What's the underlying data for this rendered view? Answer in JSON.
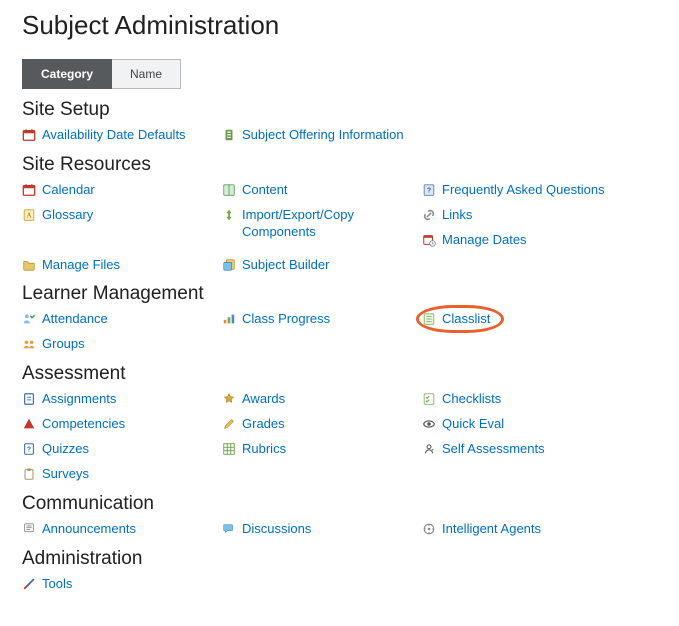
{
  "pageTitle": "Subject Administration",
  "tabs": {
    "category": "Category",
    "name": "Name"
  },
  "sections": {
    "siteSetup": {
      "heading": "Site Setup",
      "items": {
        "availabilityDateDefaults": "Availability Date Defaults",
        "subjectOfferingInformation": "Subject Offering Information"
      }
    },
    "siteResources": {
      "heading": "Site Resources",
      "items": {
        "calendar": "Calendar",
        "content": "Content",
        "faq": "Frequently Asked Questions",
        "glossary": "Glossary",
        "importExportCopy": "Import/Export/Copy Components",
        "links": "Links",
        "manageDates": "Manage Dates",
        "manageFiles": "Manage Files",
        "subjectBuilder": "Subject Builder"
      }
    },
    "learnerManagement": {
      "heading": "Learner Management",
      "items": {
        "attendance": "Attendance",
        "classProgress": "Class Progress",
        "classlist": "Classlist",
        "groups": "Groups"
      }
    },
    "assessment": {
      "heading": "Assessment",
      "items": {
        "assignments": "Assignments",
        "awards": "Awards",
        "checklists": "Checklists",
        "competencies": "Competencies",
        "grades": "Grades",
        "quickEval": "Quick Eval",
        "quizzes": "Quizzes",
        "rubrics": "Rubrics",
        "selfAssessments": "Self Assessments",
        "surveys": "Surveys"
      }
    },
    "communication": {
      "heading": "Communication",
      "items": {
        "announcements": "Announcements",
        "discussions": "Discussions",
        "intelligentAgents": "Intelligent Agents"
      }
    },
    "administration": {
      "heading": "Administration",
      "items": {
        "tools": "Tools"
      }
    }
  }
}
